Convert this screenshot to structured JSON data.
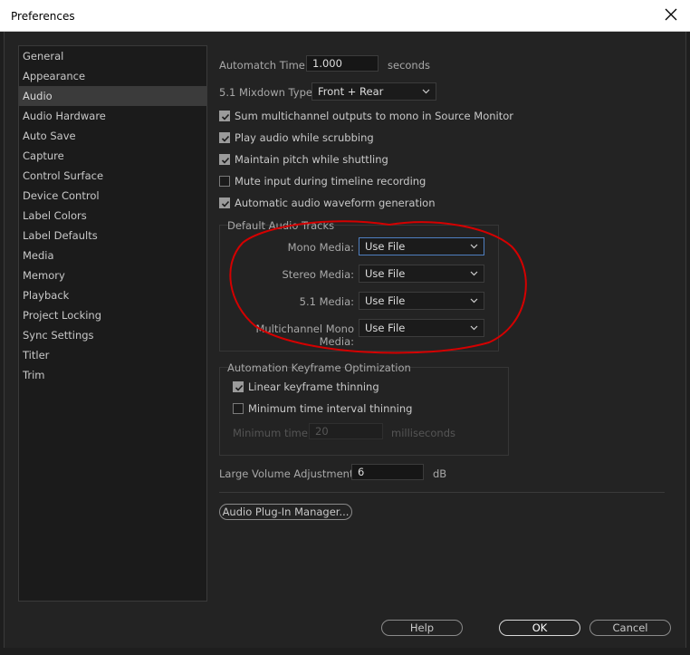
{
  "window": {
    "title": "Preferences"
  },
  "sidebar": {
    "items": [
      {
        "label": "General"
      },
      {
        "label": "Appearance"
      },
      {
        "label": "Audio",
        "active": true
      },
      {
        "label": "Audio Hardware"
      },
      {
        "label": "Auto Save"
      },
      {
        "label": "Capture"
      },
      {
        "label": "Control Surface"
      },
      {
        "label": "Device Control"
      },
      {
        "label": "Label Colors"
      },
      {
        "label": "Label Defaults"
      },
      {
        "label": "Media"
      },
      {
        "label": "Memory"
      },
      {
        "label": "Playback"
      },
      {
        "label": "Project Locking"
      },
      {
        "label": "Sync Settings"
      },
      {
        "label": "Titler"
      },
      {
        "label": "Trim"
      }
    ]
  },
  "audio": {
    "automatch_label": "Automatch Time:",
    "automatch_value": "1.000",
    "automatch_unit": "seconds",
    "mixdown_label": "5.1 Mixdown Type:",
    "mixdown_value": "Front + Rear",
    "checkboxes": [
      {
        "label": "Sum multichannel outputs to mono in Source Monitor",
        "checked": true
      },
      {
        "label": "Play audio while scrubbing",
        "checked": true
      },
      {
        "label": "Maintain pitch while shuttling",
        "checked": true
      },
      {
        "label": "Mute input during timeline recording",
        "checked": false
      },
      {
        "label": "Automatic audio waveform generation",
        "checked": true
      }
    ],
    "default_tracks": {
      "title": "Default Audio Tracks",
      "rows": [
        {
          "label": "Mono Media:",
          "value": "Use File"
        },
        {
          "label": "Stereo Media:",
          "value": "Use File"
        },
        {
          "label": "5.1 Media:",
          "value": "Use File"
        },
        {
          "label": "Multichannel Mono Media:",
          "value": "Use File"
        }
      ]
    },
    "keyframe": {
      "title": "Automation Keyframe Optimization",
      "linear_label": "Linear keyframe thinning",
      "linear_checked": true,
      "min_interval_label": "Minimum time interval thinning",
      "min_interval_checked": false,
      "min_time_label": "Minimum time:",
      "min_time_value": "20",
      "min_time_unit": "milliseconds"
    },
    "volume_label": "Large Volume Adjustment:",
    "volume_value": "6",
    "volume_unit": "dB",
    "plugin_button": "Audio Plug-In Manager..."
  },
  "footer": {
    "help": "Help",
    "ok": "OK",
    "cancel": "Cancel"
  },
  "colors": {
    "annotation": "#d40000",
    "focus": "#4f7fc0"
  }
}
